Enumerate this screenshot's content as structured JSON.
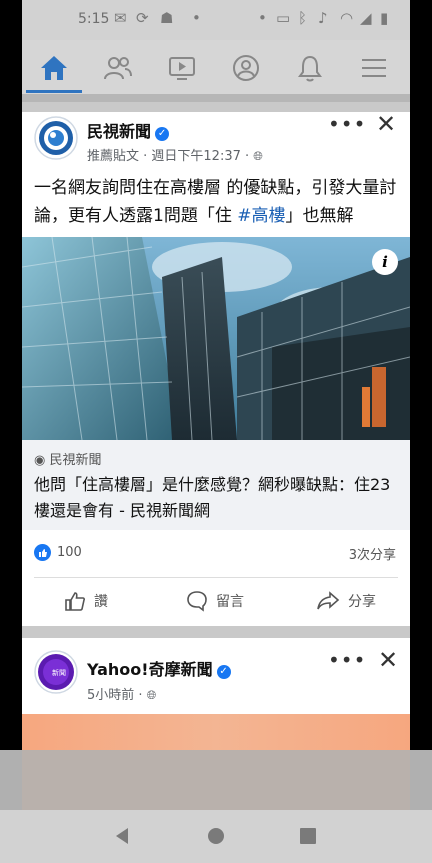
{
  "status": {
    "time": "5:15"
  },
  "post1": {
    "page_name": "民視新聞",
    "meta": "推薦貼文 · 週日下午12:37 ·",
    "text_before": "一名網友詢問住在高樓層 的優缺點，引發大量討論，更有人透露1問題「住 ",
    "hashtag": "#高樓",
    "text_after": "」也無解",
    "link_source": "民視新聞",
    "link_title": "他問「住高樓層」是什麼感覺？網秒曝缺點：住23樓還是會有 - 民視新聞網",
    "like_count": "100",
    "share_count": "3次分享",
    "actions": {
      "like": "讚",
      "comment": "留言",
      "share": "分享"
    }
  },
  "post2": {
    "page_name": "Yahoo!奇摩新聞",
    "meta": "5小時前 ·",
    "avatar_text": "新聞"
  },
  "colors": {
    "accent": "#1877f2",
    "nav_active": "#2f74c0"
  }
}
